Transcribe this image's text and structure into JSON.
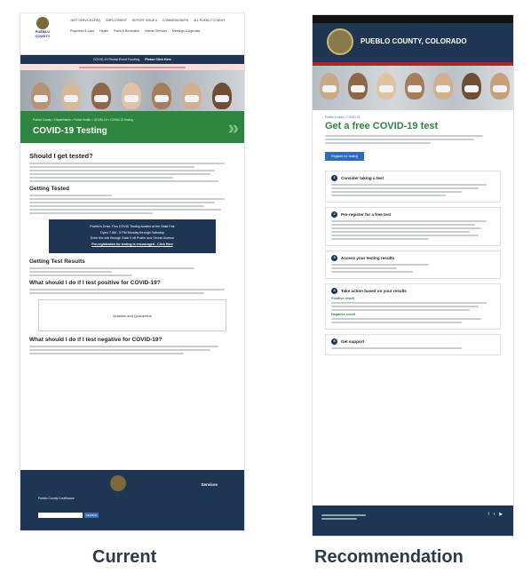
{
  "current": {
    "logo_text": "PUEBLO COUNTY",
    "nav": [
      "Properties & Land",
      "Health",
      "Parks & Recreation",
      "Human Services",
      "Meetings & Agendas"
    ],
    "top_links": [
      "JUST SERVICES/FAQ",
      "EMPLOYMENT",
      "REPORT ISSUE #",
      "COMMISSIONERS",
      "ALL PUEBLO COUNTY"
    ],
    "bar_text": "COVID-19 Rental Event Funding",
    "bar_link": "Please Click Here",
    "breadcrumb": "Pueblo County > Departments > Public Health > COVID-19 > COVID-19 Testing",
    "hero_title": "COVID-19 Testing",
    "sections": {
      "should_test": "Should I get tested?",
      "getting_tested": "Getting Tested",
      "results": "Getting Test Results",
      "positive": "What should I do if I test positive for COVID-19?",
      "negative": "What should I do if I test negative for COVID-19?"
    },
    "box_title": "Pueblo's Drive-Thru COVID Testing located at the State Fair",
    "box_hours": "Open 7 AM - 5 PM Monday through Saturday",
    "box_closed": "Enter the site through Gate 5 off Prairie and Orman Avenue",
    "box_link": "Pre-registration for testing is encouraged - Click Here",
    "video_label": "Isolation and Quarantine",
    "footer_services": "Services",
    "footer_address": "Pueblo County Courthouse",
    "footer_button": "SEARCH"
  },
  "recommendation": {
    "logo_text": "PUEBLO COUNTY, COLORADO",
    "breadcrumb": "Pueblo County > COVID-19",
    "title": "Get a free COVID-19 test",
    "button": "Register for testing",
    "steps": [
      {
        "num": "1",
        "title": "Consider taking a test"
      },
      {
        "num": "2",
        "title": "Pre-register for a free test"
      },
      {
        "num": "3",
        "title": "Access your testing results"
      },
      {
        "num": "4",
        "title": "Take action based on your results"
      },
      {
        "num": "5",
        "title": "Get support"
      }
    ],
    "positive_label": "Positive result",
    "negative_label": "Negative result"
  },
  "captions": {
    "current": "Current",
    "recommendation": "Recommendation"
  },
  "colors": {
    "navy": "#1e3554",
    "green": "#2e8540",
    "blue": "#2e6bbf"
  }
}
